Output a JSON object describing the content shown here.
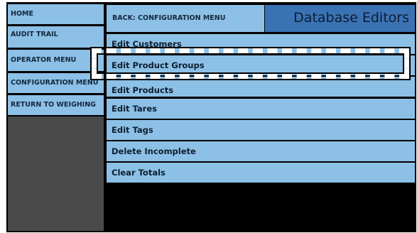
{
  "nav": {
    "items": [
      {
        "label": "HOME"
      },
      {
        "label": "AUDIT TRAIL"
      },
      {
        "label": "OPERATOR MENU"
      },
      {
        "label": "CONFIGURATION MENU"
      },
      {
        "label": "RETURN TO WEIGHING"
      }
    ]
  },
  "header": {
    "back_label": "BACK: CONFIGURATION MENU",
    "title": "Database Editors"
  },
  "menu": {
    "items": [
      {
        "label": "Edit Customers"
      },
      {
        "label": "Edit Product Groups"
      },
      {
        "label": "Edit Products"
      },
      {
        "label": "Edit Tares"
      },
      {
        "label": "Edit Tags"
      },
      {
        "label": "Delete Incomplete"
      },
      {
        "label": "Clear Totals"
      }
    ]
  },
  "colors": {
    "button_bg": "#8cc0e6",
    "title_bg": "#3a72b4",
    "frame_bg": "#000000",
    "nav_filler": "#4a4a4a"
  }
}
